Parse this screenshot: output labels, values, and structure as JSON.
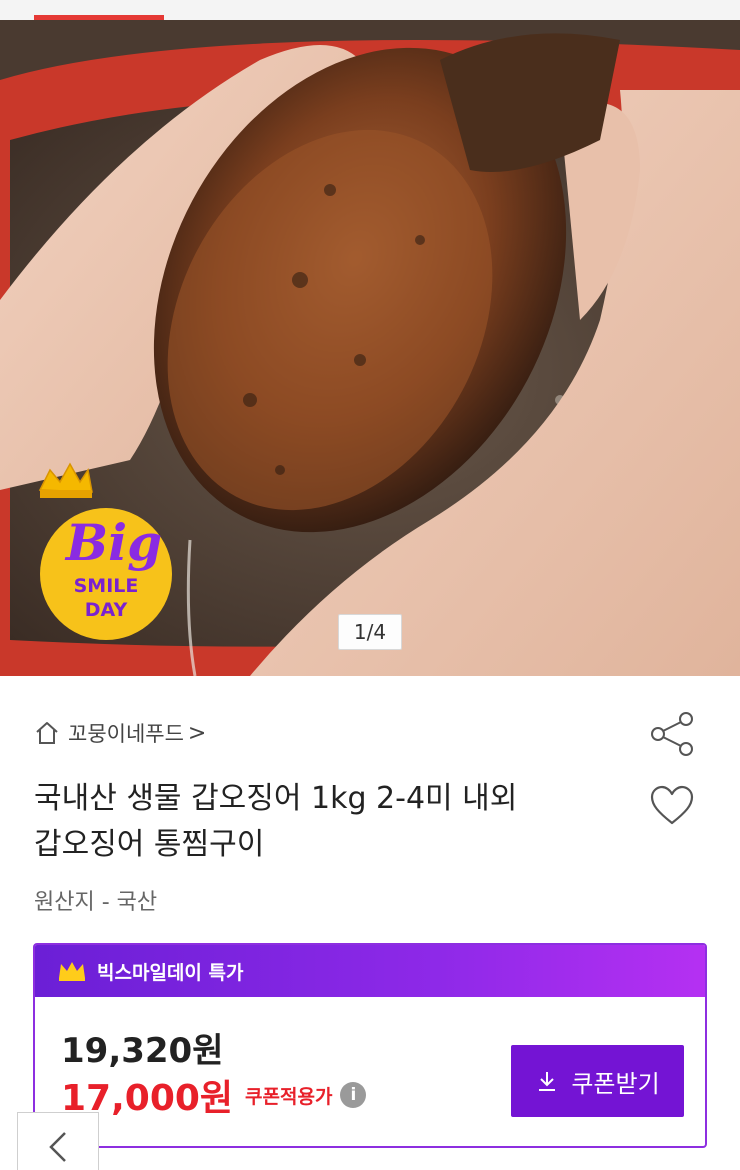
{
  "hero": {
    "page_indicator": "1/4",
    "progress_fraction": 0.18
  },
  "badge": {
    "line1": "Big",
    "line2": "SMILE",
    "line3": "DAY"
  },
  "product": {
    "store_name": "꼬뭉이네푸드",
    "store_chevron": ">",
    "title_line1": "국내산 생물 갑오징어 1kg 2-4미 내외",
    "title_line2": "갑오징어 통찜구이",
    "origin": "원산지 - 국산"
  },
  "deal": {
    "header_label": "빅스마일데이 특가",
    "original_price": "19,320원",
    "sale_price": "17,000원",
    "sale_label": "쿠폰적용가",
    "info_glyph": "i",
    "coupon_button_label": "쿠폰받기"
  },
  "icons": {
    "home": "home-icon",
    "share": "share-icon",
    "heart": "heart-icon",
    "crown": "crown-icon",
    "download": "download-icon",
    "back": "chevron-left-icon"
  },
  "colors": {
    "accent_purple": "#7414d4",
    "sale_red": "#e8202a",
    "progress_red": "#e53935",
    "badge_yellow": "#f7c21a"
  }
}
